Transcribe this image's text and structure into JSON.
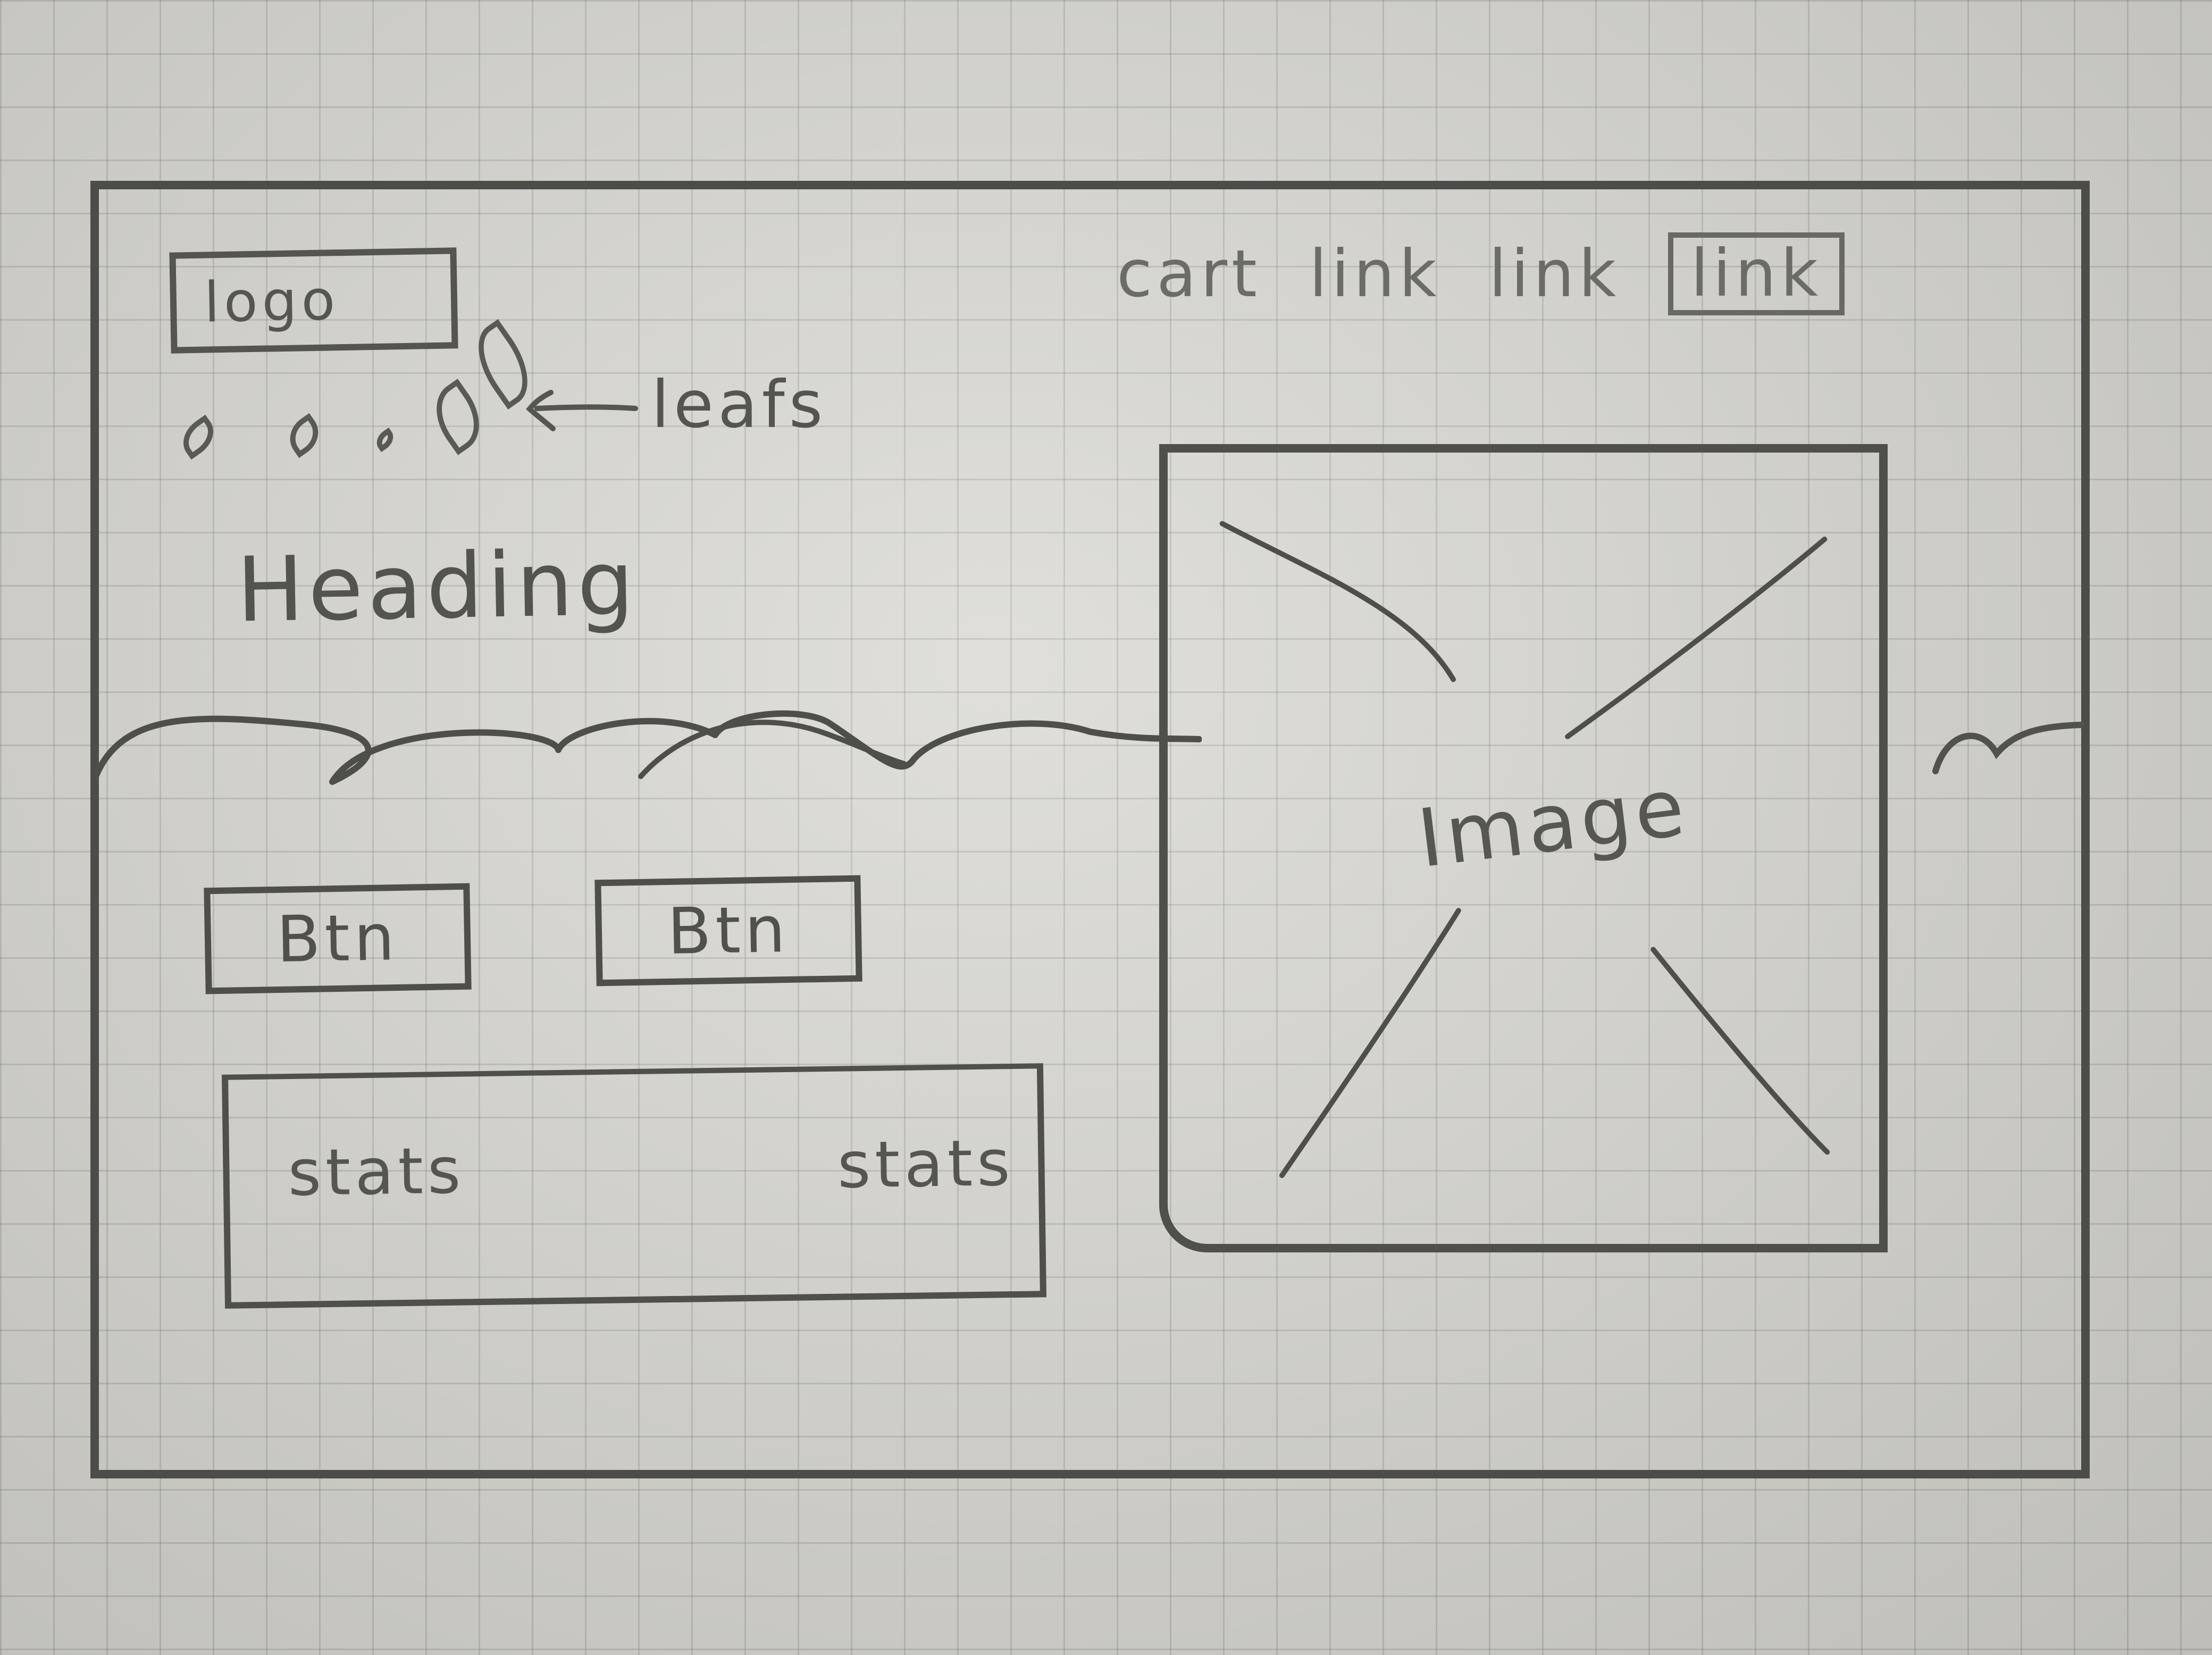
{
  "header": {
    "logo": "logo",
    "nav": [
      "cart",
      "link",
      "link",
      "link"
    ]
  },
  "leaves": {
    "label": "leafs",
    "icon_name": "leaf-icon"
  },
  "hero": {
    "heading": "Heading",
    "buttons": [
      "Btn",
      "Btn"
    ],
    "image_label": "Image"
  },
  "stats": [
    "stats",
    "stats"
  ],
  "decor": {
    "wave_name": "wavy-divider",
    "image_placeholder_icon": "image-placeholder-icon"
  }
}
